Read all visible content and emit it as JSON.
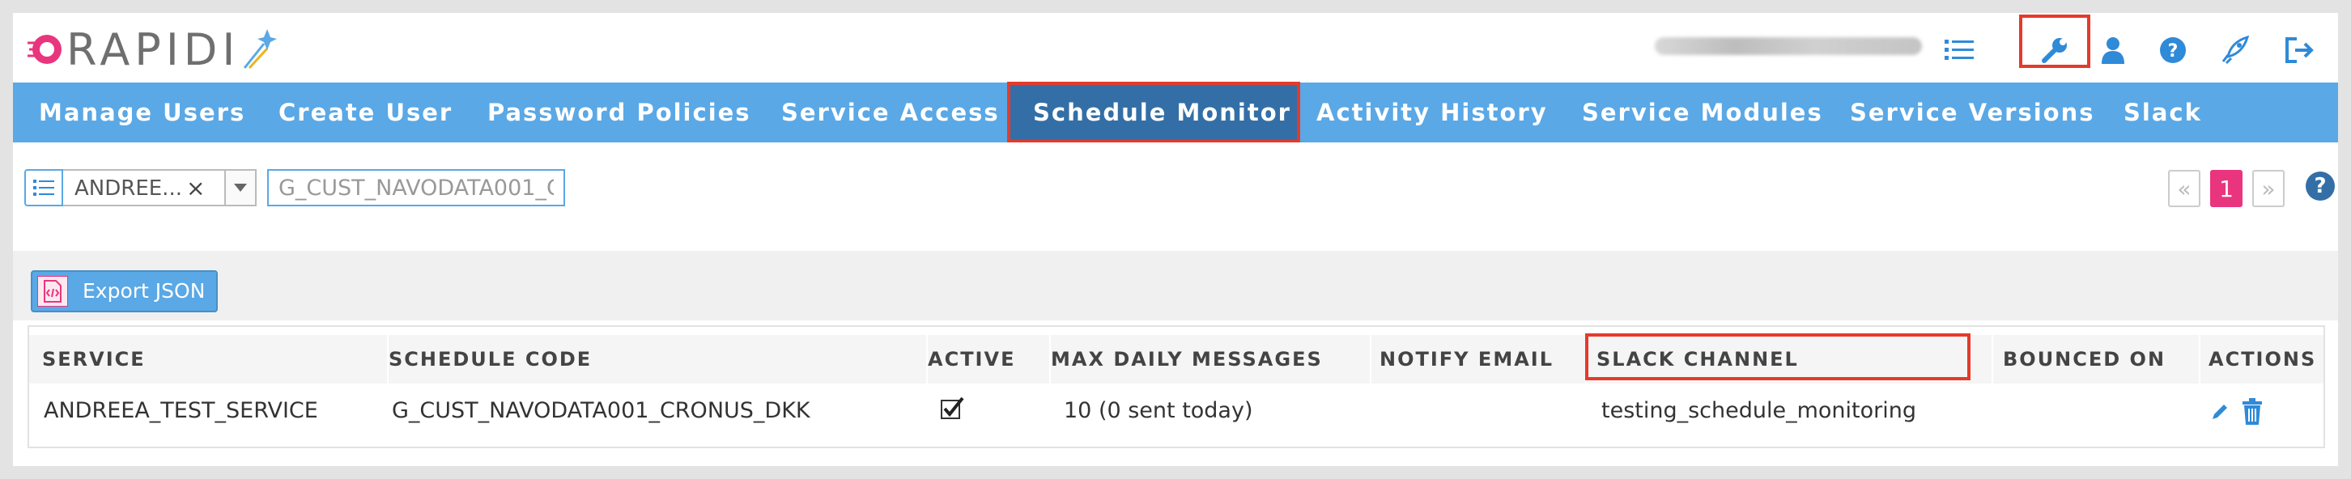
{
  "header": {
    "logo_text": "RAPIDI",
    "icons": [
      "list-icon",
      "wrench-icon",
      "user-icon",
      "help-icon",
      "rocket-icon",
      "logout-icon"
    ]
  },
  "nav": {
    "items": [
      {
        "label": "Manage Users"
      },
      {
        "label": "Create User"
      },
      {
        "label": "Password Policies"
      },
      {
        "label": "Service Access"
      },
      {
        "label": "Schedule Monitor"
      },
      {
        "label": "Activity History"
      },
      {
        "label": "Service Modules"
      },
      {
        "label": "Service Versions"
      },
      {
        "label": "Slack"
      }
    ],
    "active_index": 4
  },
  "filter": {
    "selected_service": "ANDREE...",
    "clear_symbol": "×",
    "search_value": "G_CUST_NAVODATA001_C",
    "pager_prev": "«",
    "pager_current": "1",
    "pager_next": "»",
    "help": "?"
  },
  "toolbar": {
    "export_label": "Export JSON"
  },
  "table": {
    "columns": [
      "SERVICE",
      "SCHEDULE CODE",
      "ACTIVE",
      "MAX DAILY MESSAGES",
      "NOTIFY EMAIL",
      "SLACK CHANNEL",
      "BOUNCED ON",
      "ACTIONS"
    ],
    "rows": [
      {
        "service": "ANDREEA_TEST_SERVICE",
        "schedule_code": "G_CUST_NAVODATA001_CRONUS_DKK",
        "active": true,
        "max_daily_messages": "10 (0 sent today)",
        "notify_email": "",
        "slack_channel": "testing_schedule_monitoring",
        "bounced_on": ""
      }
    ]
  },
  "colors": {
    "nav_bg": "#5aa8e6",
    "nav_active": "#336fa6",
    "accent_pink": "#e9357e",
    "highlight_red": "#e53a2b"
  }
}
